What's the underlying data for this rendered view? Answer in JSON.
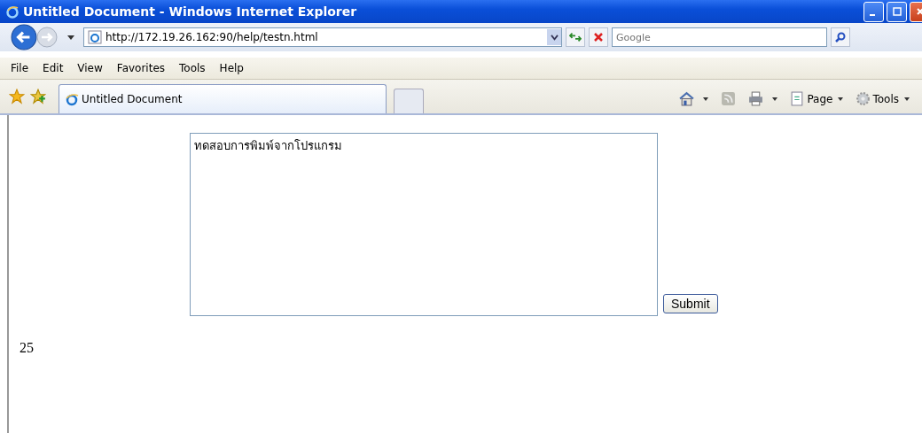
{
  "window": {
    "title": "Untitled Document - Windows Internet Explorer"
  },
  "address_bar": {
    "url": "http://172.19.26.162:90/help/testn.html"
  },
  "search": {
    "placeholder": "Google"
  },
  "menu": [
    "File",
    "Edit",
    "View",
    "Favorites",
    "Tools",
    "Help"
  ],
  "tabs": [
    {
      "label": "Untitled Document",
      "selected": true
    }
  ],
  "command_bar": [
    {
      "kind": "home"
    },
    {
      "kind": "feeds"
    },
    {
      "kind": "print"
    },
    {
      "kind": "page",
      "label": "Page"
    },
    {
      "kind": "tools",
      "label": "Tools"
    }
  ],
  "page": {
    "textarea": {
      "value": "ทดสอบการพิมพ์จากโปรแกรม"
    },
    "submit": "Submit",
    "count": "25"
  }
}
